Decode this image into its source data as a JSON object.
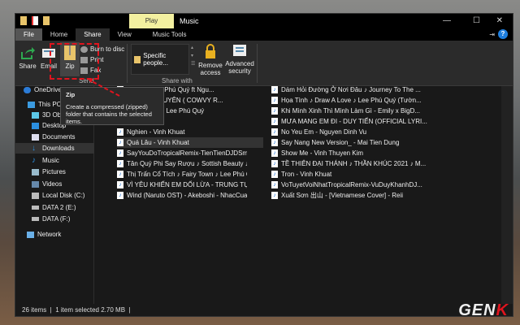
{
  "window": {
    "title": "Music",
    "context_tab": "Play",
    "controls": {
      "minimize": "—",
      "maximize": "☐",
      "close": "✕"
    },
    "help": "?"
  },
  "tabs": [
    {
      "label": "File"
    },
    {
      "label": "Home"
    },
    {
      "label": "Share"
    },
    {
      "label": "View"
    },
    {
      "label": "Music Tools"
    }
  ],
  "ribbon": {
    "share": "Share",
    "email": "Email",
    "zip": "Zip",
    "burn": "Burn to disc",
    "print": "Print",
    "fax": "Fax",
    "send_group": "Send",
    "specific_people": "Specific people...",
    "remove_access": "Remove access",
    "advanced_security": "Advanced security",
    "share_with_group": "Share with"
  },
  "tooltip": {
    "title": "Zip",
    "body": "Create a compressed (zipped) folder that contains the selected items."
  },
  "nav": [
    {
      "label": "OneDrive"
    },
    {
      "label": "This PC"
    },
    {
      "label": "3D Objects"
    },
    {
      "label": "Desktop"
    },
    {
      "label": "Documents"
    },
    {
      "label": "Downloads"
    },
    {
      "label": "Music"
    },
    {
      "label": "Pictures"
    },
    {
      "label": "Videos"
    },
    {
      "label": "Local Disk (C:)"
    },
    {
      "label": "DATA 2 (E:)"
    },
    {
      "label": "DATA (F:)"
    },
    {
      "label": "Network"
    }
  ],
  "files_col1": [
    "...eam ♪ Lee Phú Quý ft Ngu...",
    "...M - LỄ NGUYÊN ( COWVY R...",
    "...ld Beauty ♪ Lee Phú Quý",
    "",
    "Nghien - Vinh Khuat",
    "Quá Lâu - Vinh Khuat",
    "SayYouDoTropicalRemix-TienTienDJDSmall-39...",
    "Tân Quý Phi Say Rượu ♪ Sottish Beauty ♪ Lee P...",
    "Thị Trấn Cổ Tích ♪ Fairy Town ♪ Lee Phú Quý",
    "VÌ YÊU KHIẾN EM DỐI LỪA - TRUNG TỰ (OFFIC...",
    "Wind (Naruto OST) - Akeboshi - NhacCuaTui"
  ],
  "files_col2": [
    "Dám Hỏi Đường Ở Nơi Đâu ♪ Journey To The ...",
    "Họa Tình ♪ Draw A Love ♪ Lee Phú Quý (Tườn...",
    "Khi Mình Xinh Thì Mình Làm Gì - Emily x BigD...",
    "MƯA MANG EM ĐI - DUY TIẾN (OFFICIAL LYRI...",
    "No Yeu Em - Nguyen Dinh Vu",
    "Say Nang New Version_ - Mai Tien Dung",
    "Show Me - Vinh Thuyen Kim",
    "TỀ THIÊN ĐẠI THÁNH ♪ THẦN KHÚC 2021 ♪ M...",
    "Tron - Vinh Khuat",
    "VoTuyetVoiNhatTropicalRemix-VuDuyKhanhDJ...",
    "Xuất Sơn 出山 - [Vietnamese Cover] - Reii"
  ],
  "status": {
    "count": "26 items",
    "selected": "1 item selected  2.70 MB"
  },
  "watermark": {
    "text": "GEN",
    "accent": "K"
  },
  "colors": {
    "highlight": "#e0141e",
    "play_tab": "#f3f0a0"
  }
}
